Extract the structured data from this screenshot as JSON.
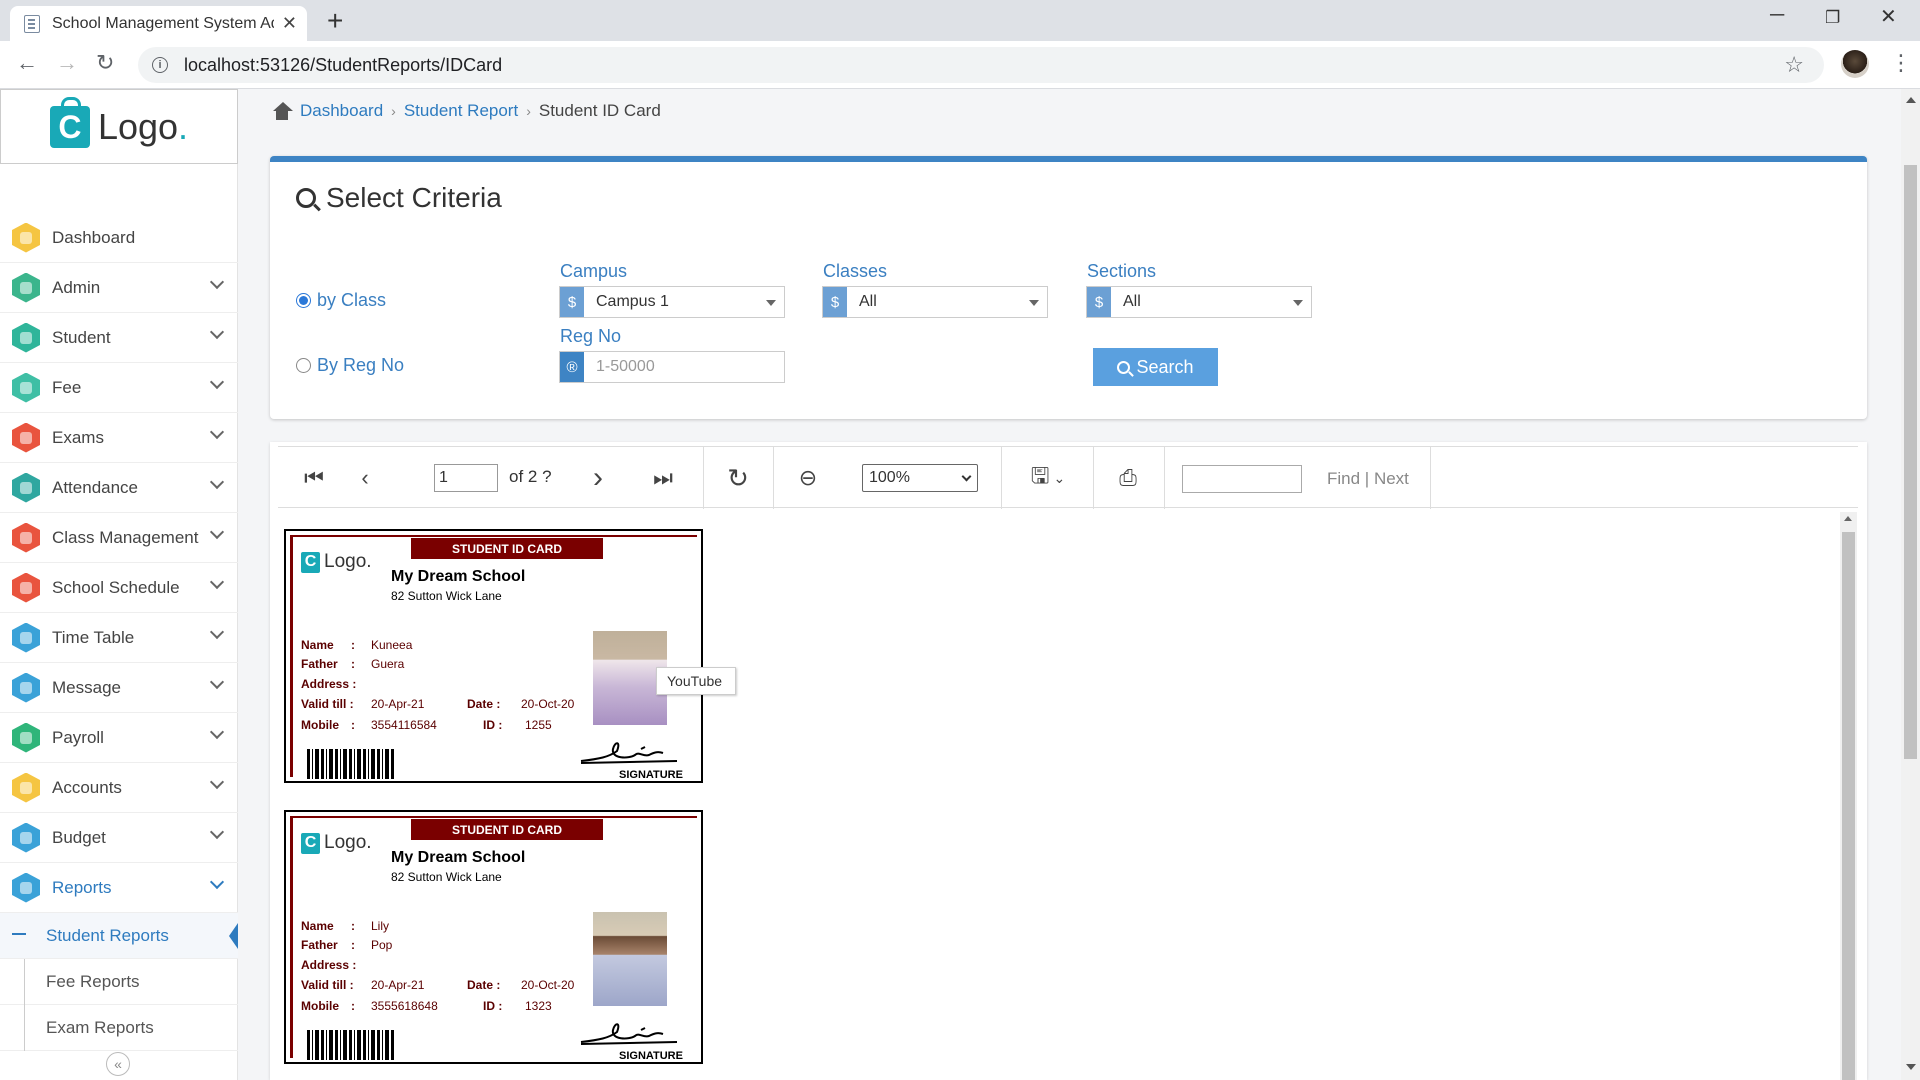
{
  "browser": {
    "tab_title": "School Management System Adr",
    "url": "localhost:53126/StudentReports/IDCard"
  },
  "logo": {
    "text": "Logo",
    "dot": "."
  },
  "sidebar": {
    "items": [
      {
        "label": "Dashboard",
        "color": "#f5c542",
        "icon": "dashboard-icon"
      },
      {
        "label": "Admin",
        "color": "#3bb58c",
        "icon": "admin-icon"
      },
      {
        "label": "Student",
        "color": "#2fb59a",
        "icon": "student-icon"
      },
      {
        "label": "Fee",
        "color": "#3fbfa5",
        "icon": "fee-icon"
      },
      {
        "label": "Exams",
        "color": "#e9543e",
        "icon": "exams-icon"
      },
      {
        "label": "Attendance",
        "color": "#2fa7a0",
        "icon": "attendance-icon"
      },
      {
        "label": "Class Management",
        "color": "#e9543e",
        "icon": "class-icon"
      },
      {
        "label": "School Schedule",
        "color": "#e9543e",
        "icon": "schedule-icon"
      },
      {
        "label": "Time Table",
        "color": "#3aa2d8",
        "icon": "timetable-icon"
      },
      {
        "label": "Message",
        "color": "#3aa2d8",
        "icon": "message-icon"
      },
      {
        "label": "Payroll",
        "color": "#2fb57a",
        "icon": "payroll-icon"
      },
      {
        "label": "Accounts",
        "color": "#f5c542",
        "icon": "accounts-icon"
      },
      {
        "label": "Budget",
        "color": "#3aa2d8",
        "icon": "budget-icon"
      },
      {
        "label": "Reports",
        "color": "#3aa2d8",
        "icon": "reports-icon"
      }
    ],
    "subitems": [
      {
        "label": "Student Reports"
      },
      {
        "label": "Fee Reports"
      },
      {
        "label": "Exam Reports"
      }
    ]
  },
  "breadcrumb": {
    "home": "Dashboard",
    "parent": "Student Report",
    "current": "Student ID Card"
  },
  "criteria": {
    "title": "Select Criteria",
    "radio_class": "by Class",
    "radio_reg": "By Reg No",
    "campus_label": "Campus",
    "campus_value": "Campus 1",
    "classes_label": "Classes",
    "classes_value": "All",
    "sections_label": "Sections",
    "sections_value": "All",
    "regno_label": "Reg No",
    "regno_placeholder": "1-50000",
    "search_label": "Search"
  },
  "viewer": {
    "page": "1",
    "of_pages": "of 2 ?",
    "zoom": "100%",
    "find": "Find",
    "next": "Next",
    "tooltip": "YouTube"
  },
  "cards": [
    {
      "header": "STUDENT ID CARD",
      "logo": "Logo.",
      "school": "My Dream School",
      "address": "82  Sutton Wick Lane",
      "name_label": "Name",
      "name": "Kuneea",
      "father_label": "Father",
      "father": "Guera",
      "address_label": "Address :",
      "valid_label": "Valid till :",
      "valid": "20-Apr-21",
      "date_label": "Date :",
      "date": "20-Oct-20",
      "mobile_label": "Mobile",
      "mobile": "3554116584",
      "id_label": "ID :",
      "id": "1255",
      "signature": "SIGNATURE"
    },
    {
      "header": "STUDENT ID CARD",
      "logo": "Logo.",
      "school": "My Dream School",
      "address": "82  Sutton Wick Lane",
      "name_label": "Name",
      "name": "Lily",
      "father_label": "Father",
      "father": "Pop",
      "address_label": "Address :",
      "valid_label": "Valid till :",
      "valid": "20-Apr-21",
      "date_label": "Date :",
      "date": "20-Oct-20",
      "mobile_label": "Mobile",
      "mobile": "3555618648",
      "id_label": "ID :",
      "id": "1323",
      "signature": "SIGNATURE"
    }
  ]
}
